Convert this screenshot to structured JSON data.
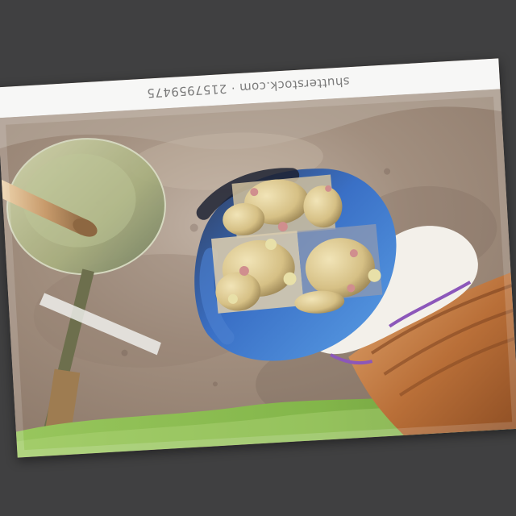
{
  "image": {
    "watermark": "shutterstock.com · 2157959475",
    "subject": "gloved hand holding sprouting seed potatoes over garden soil with a spade",
    "colors": {
      "background": "#404041",
      "soil": "#a28f7f",
      "glove_blue": "#3f6fbf",
      "glove_white": "#f2eee9",
      "sleeve": "#b96f38",
      "grass": "#8fbf53",
      "potato": "#d8c38b"
    }
  }
}
